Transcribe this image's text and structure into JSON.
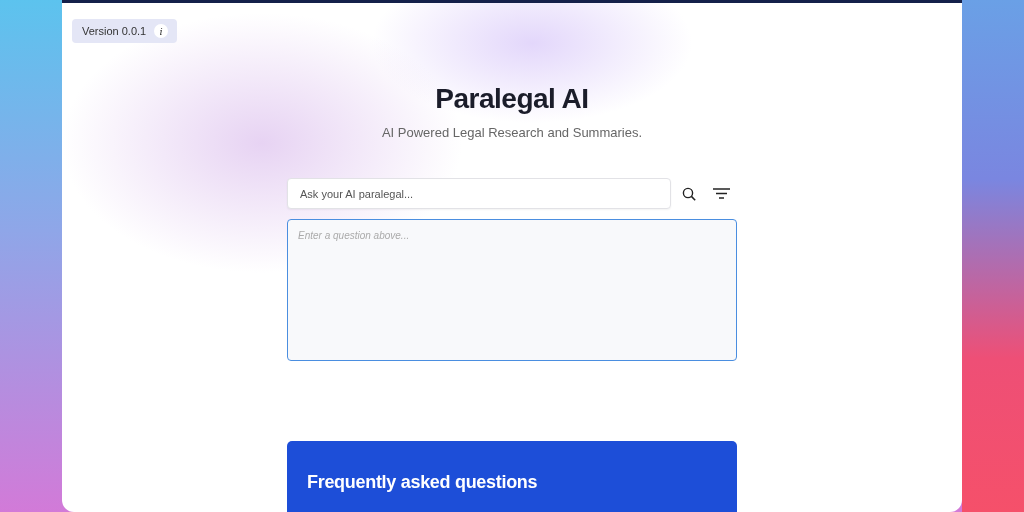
{
  "version_badge": {
    "label": "Version 0.0.1",
    "info_icon": "i"
  },
  "header": {
    "title": "Paralegal AI",
    "subtitle": "AI Powered Legal Research and Summaries."
  },
  "search": {
    "placeholder": "Ask your AI paralegal..."
  },
  "answer": {
    "placeholder": "Enter a question above..."
  },
  "faq": {
    "title": "Frequently asked questions"
  }
}
